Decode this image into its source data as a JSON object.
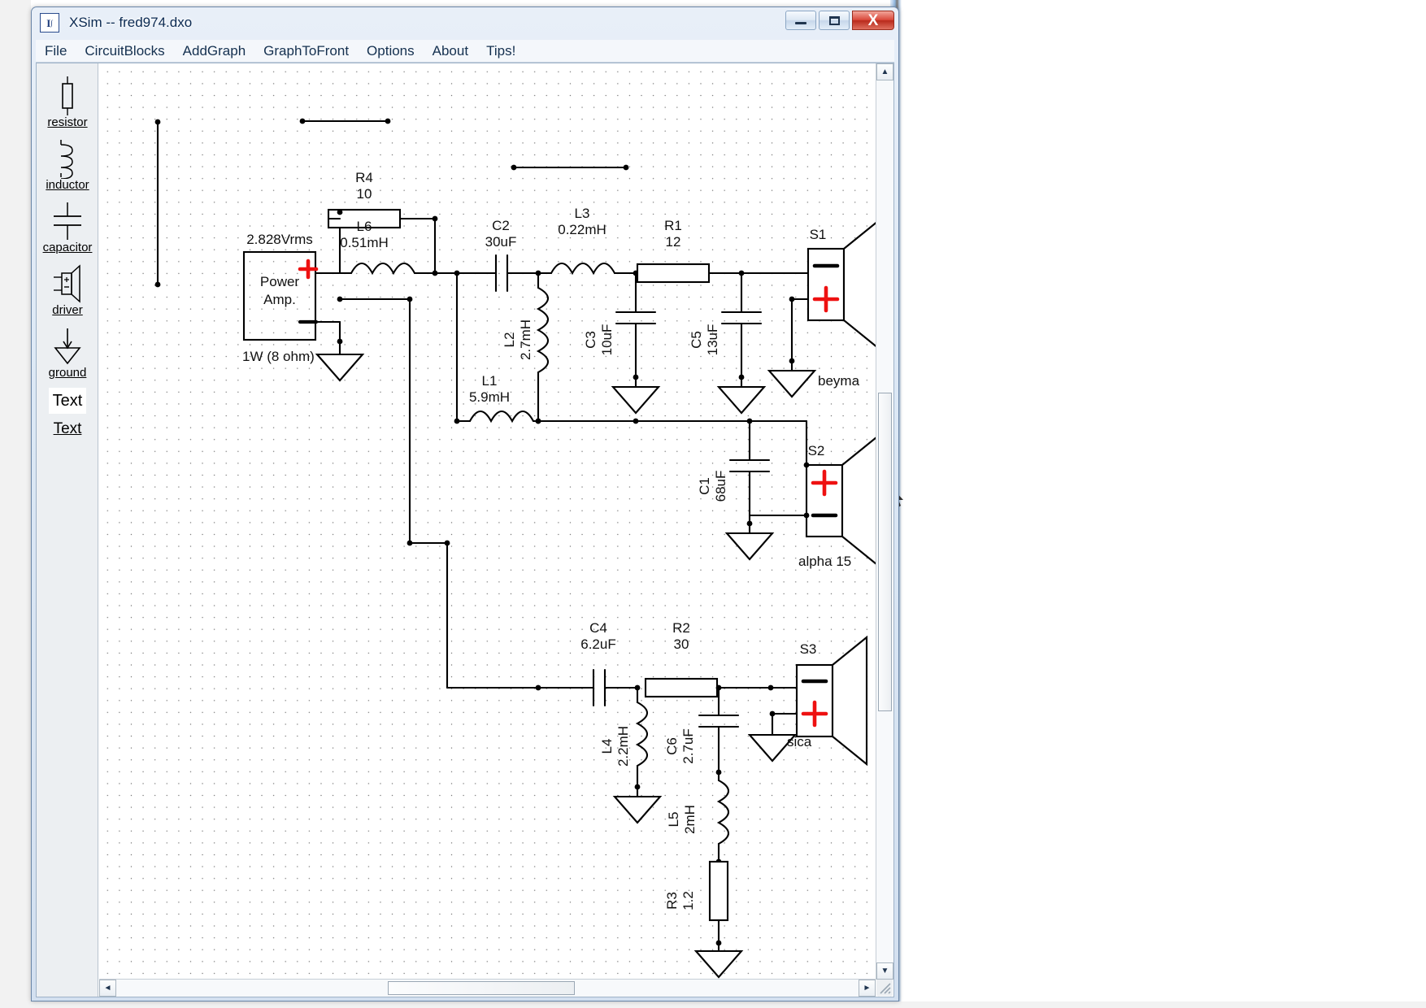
{
  "window": {
    "title": "XSim -- fred974.dxo",
    "app_icon": "xsim-icon",
    "minimize_label": "Minimize",
    "maximize_label": "Maximize",
    "close_label": "X"
  },
  "menubar": {
    "items": [
      {
        "label": "File"
      },
      {
        "label": "CircuitBlocks"
      },
      {
        "label": "AddGraph"
      },
      {
        "label": "GraphToFront"
      },
      {
        "label": "Options"
      },
      {
        "label": "About"
      },
      {
        "label": "Tips!"
      }
    ]
  },
  "palette": {
    "items": [
      {
        "label": "resistor",
        "icon": "resistor-icon"
      },
      {
        "label": "inductor",
        "icon": "inductor-icon"
      },
      {
        "label": "capacitor",
        "icon": "capacitor-icon"
      },
      {
        "label": "driver",
        "icon": "driver-icon"
      },
      {
        "label": "ground",
        "icon": "ground-icon"
      }
    ],
    "text_button": "Text",
    "text_label": "Text"
  },
  "schematic": {
    "source": {
      "title_line1": "Power",
      "title_line2": "Amp.",
      "voltage": "2.828Vrms",
      "power": "1W (8 ohm)",
      "plus": "+",
      "minus": "_"
    },
    "components": [
      {
        "ref": "R4",
        "value": "10"
      },
      {
        "ref": "L6",
        "value": "0.51mH"
      },
      {
        "ref": "C2",
        "value": "30uF"
      },
      {
        "ref": "L3",
        "value": "0.22mH"
      },
      {
        "ref": "R1",
        "value": "12"
      },
      {
        "ref": "L2",
        "value": "2.7mH"
      },
      {
        "ref": "C3",
        "value": "10uF"
      },
      {
        "ref": "C5",
        "value": "13uF"
      },
      {
        "ref": "L1",
        "value": "5.9mH"
      },
      {
        "ref": "C1",
        "value": "68uF"
      },
      {
        "ref": "C4",
        "value": "6.2uF"
      },
      {
        "ref": "R2",
        "value": "30"
      },
      {
        "ref": "L4",
        "value": "2.2mH"
      },
      {
        "ref": "C6",
        "value": "2.7uF"
      },
      {
        "ref": "L5",
        "value": "2mH"
      },
      {
        "ref": "R3",
        "value": "1.2"
      }
    ],
    "drivers": [
      {
        "ref": "S1",
        "name": "beyma",
        "polarity_top": "−",
        "polarity_bottom": "+"
      },
      {
        "ref": "S2",
        "name": "alpha 15",
        "polarity_top": "+",
        "polarity_bottom": "−"
      },
      {
        "ref": "S3",
        "name": "sica",
        "polarity_top": "−",
        "polarity_bottom": "+"
      }
    ],
    "accent_color": "#ee1111",
    "wire_color": "#000000",
    "grid_dot_color": "#767676"
  },
  "scrollbars": {
    "v_up": "▲",
    "v_down": "▼",
    "h_left": "◄",
    "h_right": "►"
  }
}
